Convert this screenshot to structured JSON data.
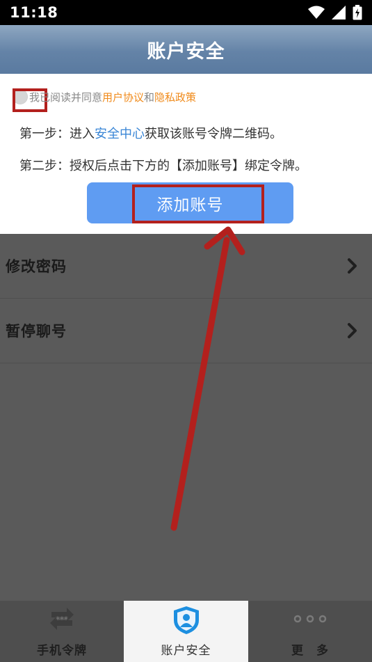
{
  "status_bar": {
    "time": "11:18",
    "icons": [
      "wifi-icon",
      "signal-icon",
      "battery-icon"
    ]
  },
  "header": {
    "title": "账户安全"
  },
  "agreement": {
    "prefix": "我已阅读并同意",
    "user_agreement": "用户协议",
    "conjunction": "和",
    "privacy_policy": "隐私政策",
    "checked": false
  },
  "steps": {
    "step1_prefix": "第一步：进入",
    "step1_link": "安全中心",
    "step1_suffix": "获取该账号令牌二维码。",
    "step2": "第二步：授权后点击下方的【添加账号】绑定令牌。"
  },
  "add_button": {
    "label": "添加账号"
  },
  "menu": {
    "items": [
      {
        "label": "修改密码",
        "icon": "chevron-right-icon"
      },
      {
        "label": "暂停聊号",
        "icon": "chevron-right-icon"
      }
    ]
  },
  "tabbar": {
    "tabs": [
      {
        "label": "手机令牌",
        "icon": "token-icon",
        "active": false
      },
      {
        "label": "账户安全",
        "icon": "shield-user-icon",
        "active": true
      },
      {
        "label": "更　多",
        "icon": "more-dots-icon",
        "active": false
      }
    ]
  },
  "colors": {
    "title_bar": "#6483a7",
    "button": "#5f9cf2",
    "link_orange": "#f08a1a",
    "link_blue": "#3a86d6",
    "annotation_red": "#b3201d",
    "overlay_dim": "#5a5a5a"
  }
}
